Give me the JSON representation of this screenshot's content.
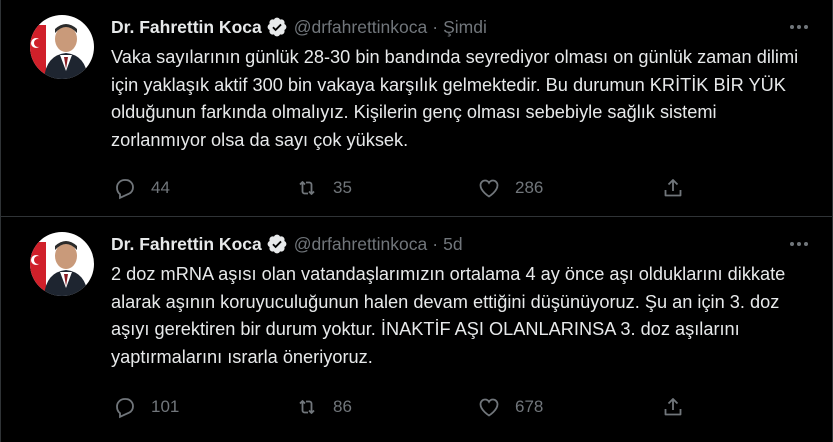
{
  "colors": {
    "background": "#000000",
    "text": "#e7e9ea",
    "muted": "#71767b",
    "divider": "#2f3336",
    "verified": "#e7e9ea"
  },
  "tweets": [
    {
      "name": "Dr. Fahrettin Koca",
      "handle": "@drfahrettinkoca",
      "separator": "·",
      "time": "Şimdi",
      "text": "Vaka sayılarının günlük 28-30 bin bandında seyrediyor olması on günlük zaman dilimi için yaklaşık aktif 300 bin vakaya karşılık gelmektedir. Bu durumun KRİTİK BİR YÜK olduğunun farkında olmalıyız. Kişilerin genç olması sebebiyle sağlık sistemi zorlanmıyor olsa da sayı çok yüksek.",
      "replies": "44",
      "retweets": "35",
      "likes": "286",
      "icons": [
        "reply-icon",
        "retweet-icon",
        "like-icon",
        "share-icon"
      ]
    },
    {
      "name": "Dr. Fahrettin Koca",
      "handle": "@drfahrettinkoca",
      "separator": "·",
      "time": "5d",
      "text": "2 doz mRNA aşısı olan vatandaşlarımızın ortalama 4 ay önce aşı olduklarını dikkate alarak aşının koruyuculuğunun halen devam ettiğini düşünüyoruz. Şu an için 3. doz aşıyı gerektiren bir durum yoktur. İNAKTİF AŞI OLANLARINSA 3. doz aşılarını yaptırmalarını ısrarla öneriyoruz.",
      "replies": "101",
      "retweets": "86",
      "likes": "678",
      "icons": [
        "reply-icon",
        "retweet-icon",
        "like-icon",
        "share-icon"
      ]
    }
  ]
}
